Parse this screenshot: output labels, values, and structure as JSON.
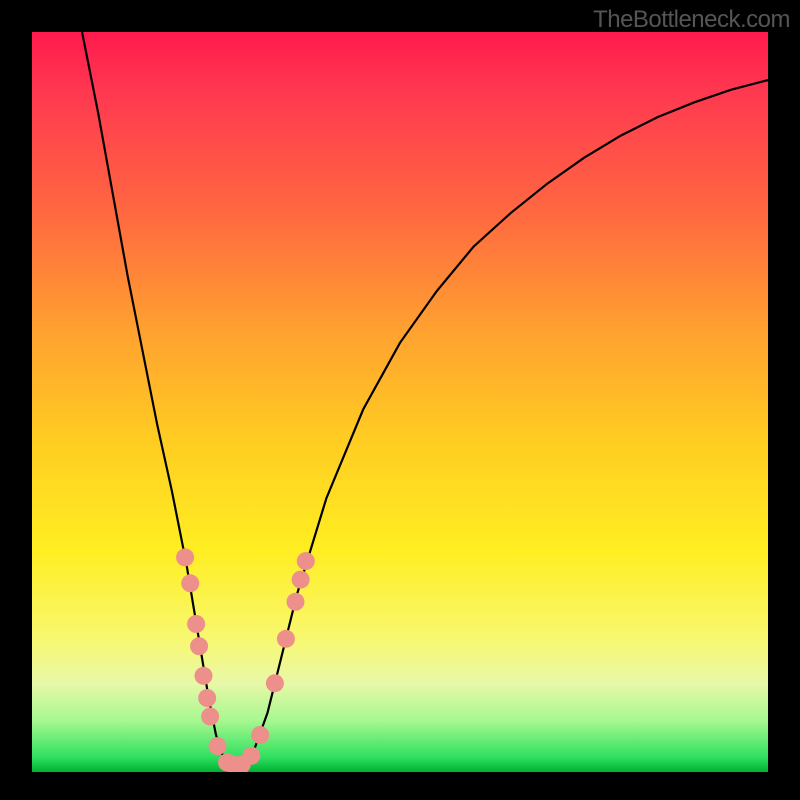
{
  "attribution": "TheBottleneck.com",
  "chart_data": {
    "type": "line",
    "title": "",
    "xlabel": "",
    "ylabel": "",
    "xlim": [
      0,
      100
    ],
    "ylim": [
      0,
      100
    ],
    "description": "V-shaped bottleneck curve on rainbow gradient background (red high / green low). Minimum of curve sits near x≈26, y≈0. Pink data points cluster on both branches near the bottom of the V.",
    "curve": [
      {
        "x": 6.8,
        "y": 100.0
      },
      {
        "x": 9.0,
        "y": 89.0
      },
      {
        "x": 11.0,
        "y": 78.0
      },
      {
        "x": 13.0,
        "y": 67.0
      },
      {
        "x": 15.0,
        "y": 57.0
      },
      {
        "x": 17.0,
        "y": 47.0
      },
      {
        "x": 19.0,
        "y": 38.0
      },
      {
        "x": 21.0,
        "y": 28.0
      },
      {
        "x": 22.0,
        "y": 22.0
      },
      {
        "x": 23.0,
        "y": 16.0
      },
      {
        "x": 24.0,
        "y": 10.0
      },
      {
        "x": 25.0,
        "y": 5.0
      },
      {
        "x": 26.0,
        "y": 2.0
      },
      {
        "x": 27.0,
        "y": 1.0
      },
      {
        "x": 28.5,
        "y": 1.0
      },
      {
        "x": 30.0,
        "y": 2.5
      },
      {
        "x": 32.0,
        "y": 8.0
      },
      {
        "x": 34.0,
        "y": 16.0
      },
      {
        "x": 36.0,
        "y": 24.0
      },
      {
        "x": 40.0,
        "y": 37.0
      },
      {
        "x": 45.0,
        "y": 49.0
      },
      {
        "x": 50.0,
        "y": 58.0
      },
      {
        "x": 55.0,
        "y": 65.0
      },
      {
        "x": 60.0,
        "y": 71.0
      },
      {
        "x": 65.0,
        "y": 75.5
      },
      {
        "x": 70.0,
        "y": 79.5
      },
      {
        "x": 75.0,
        "y": 83.0
      },
      {
        "x": 80.0,
        "y": 86.0
      },
      {
        "x": 85.0,
        "y": 88.5
      },
      {
        "x": 90.0,
        "y": 90.5
      },
      {
        "x": 95.0,
        "y": 92.2
      },
      {
        "x": 100.0,
        "y": 93.5
      }
    ],
    "points": [
      {
        "x": 20.8,
        "y": 29.0
      },
      {
        "x": 21.5,
        "y": 25.5
      },
      {
        "x": 22.3,
        "y": 20.0
      },
      {
        "x": 22.7,
        "y": 17.0
      },
      {
        "x": 23.3,
        "y": 13.0
      },
      {
        "x": 23.8,
        "y": 10.0
      },
      {
        "x": 24.2,
        "y": 7.5
      },
      {
        "x": 25.2,
        "y": 3.5
      },
      {
        "x": 26.5,
        "y": 1.3
      },
      {
        "x": 27.3,
        "y": 1.0
      },
      {
        "x": 28.5,
        "y": 1.0
      },
      {
        "x": 29.8,
        "y": 2.2
      },
      {
        "x": 31.0,
        "y": 5.0
      },
      {
        "x": 33.0,
        "y": 12.0
      },
      {
        "x": 34.5,
        "y": 18.0
      },
      {
        "x": 35.8,
        "y": 23.0
      },
      {
        "x": 36.5,
        "y": 26.0
      },
      {
        "x": 37.2,
        "y": 28.5
      }
    ]
  }
}
